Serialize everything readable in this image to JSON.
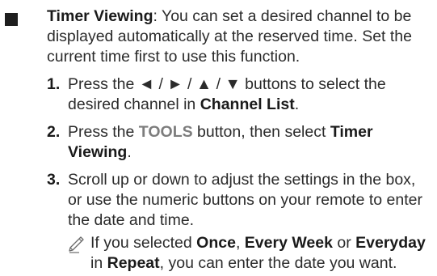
{
  "intro": {
    "title": "Timer Viewing",
    "sep": ": ",
    "body": "You can set a desired channel to be displayed automatically at the reserved time. Set the current time first to use this function."
  },
  "steps": [
    {
      "num": "1.",
      "t1": "Press the ◄ / ► / ▲ / ▼ buttons to select the desired channel in ",
      "b1": "Channel List",
      "t2": "."
    },
    {
      "num": "2.",
      "t1": "Press the ",
      "g1": "TOOLS",
      "t2": " button, then select ",
      "b1": "Timer Viewing",
      "t3": "."
    },
    {
      "num": "3.",
      "t1": "Scroll up or down to adjust the settings in the box, or use the numeric buttons on your remote to enter the date and time."
    }
  ],
  "note": {
    "icon": "pencil-note-icon",
    "t1": "If you selected ",
    "b1": "Once",
    "t2": ", ",
    "b2": "Every Week",
    "t3": " or ",
    "b3": "Everyday",
    "t4": " in ",
    "b4": "Repeat",
    "t5": ", you can enter the date you want."
  }
}
